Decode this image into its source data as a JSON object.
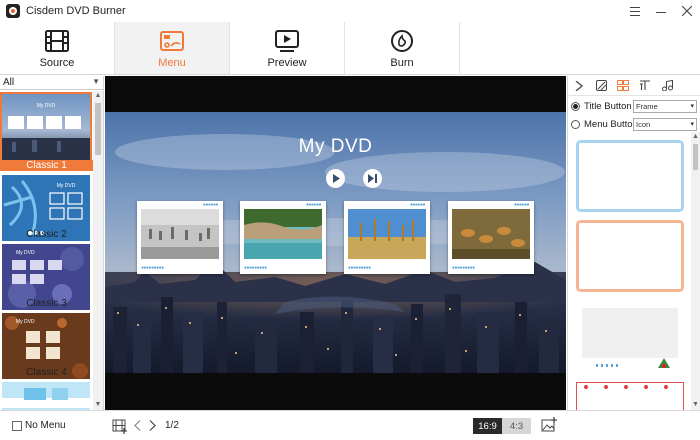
{
  "app": {
    "title": "Cisdem DVD Burner"
  },
  "toolbar": {
    "tabs": [
      {
        "label": "Source",
        "icon": "film-icon",
        "active": false
      },
      {
        "label": "Menu",
        "icon": "menu-icon",
        "active": true
      },
      {
        "label": "Preview",
        "icon": "play-screen-icon",
        "active": false
      },
      {
        "label": "Burn",
        "icon": "disc-burn-icon",
        "active": false
      }
    ]
  },
  "colors": {
    "accent": "#f07a3a",
    "selected_label_bg": "#f07a3a"
  },
  "left_panel": {
    "filter": "All",
    "templates": [
      {
        "label": "Classic 1",
        "selected": true
      },
      {
        "label": "Classic 2",
        "selected": false
      },
      {
        "label": "Classic 3",
        "selected": false
      },
      {
        "label": "Classic 4",
        "selected": false
      }
    ]
  },
  "preview": {
    "menu_title": "My DVD",
    "buttons": [
      "play-icon",
      "next-chapter-icon"
    ]
  },
  "right_panel": {
    "tabs": [
      "chevron-right-icon",
      "background-icon",
      "layout-icon",
      "text-icon",
      "music-icon"
    ],
    "title_button": {
      "label": "Title Button",
      "value": "Frame",
      "checked": true
    },
    "menu_button": {
      "label": "Menu Button",
      "value": "Icon",
      "checked": false
    }
  },
  "bottom": {
    "no_menu_label": "No Menu",
    "page": "1/2",
    "ratio_on": "16:9",
    "ratio_off": "4:3"
  }
}
